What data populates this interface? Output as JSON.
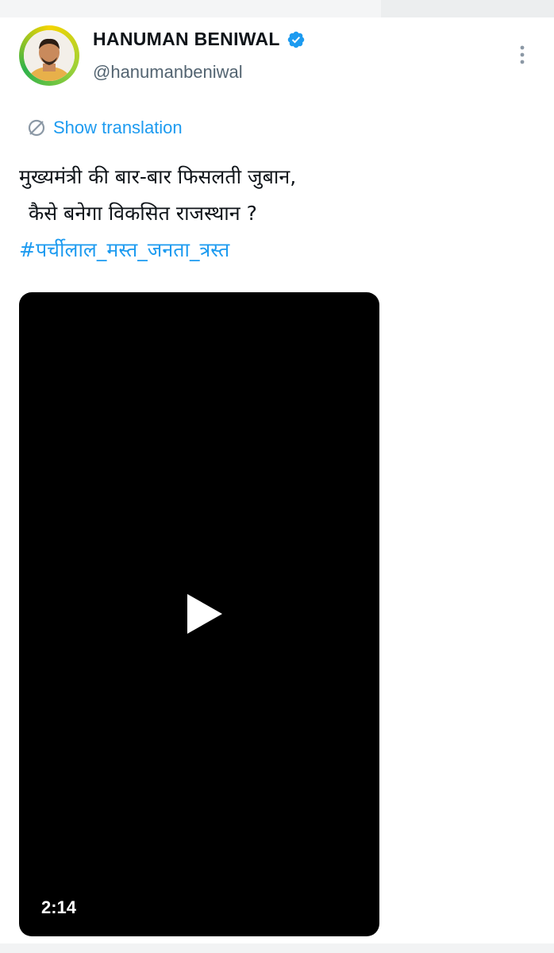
{
  "profile": {
    "name": "HANUMAN BENIWAL",
    "handle": "@hanumanbeniwal",
    "avatar_icon": "profile-photo",
    "verified_icon": "verified-badge-icon",
    "verified_color": "#1d9bf0"
  },
  "menu": {
    "icon": "more-vertical-icon"
  },
  "translation": {
    "label": "Show translation",
    "icon": "globe-translate-icon",
    "color": "#1d9bf0"
  },
  "tweet": {
    "line1": "मुख्यमंत्री की बार-बार फिसलती जुबान,",
    "line2": "कैसे बनेगा विकसित राजस्थान ?",
    "hashtag": "#पर्चीलाल_मस्त_जनता_त्रस्त",
    "hashtag_color": "#1d9bf0"
  },
  "video": {
    "duration": "2:14",
    "play_icon": "play-icon"
  }
}
